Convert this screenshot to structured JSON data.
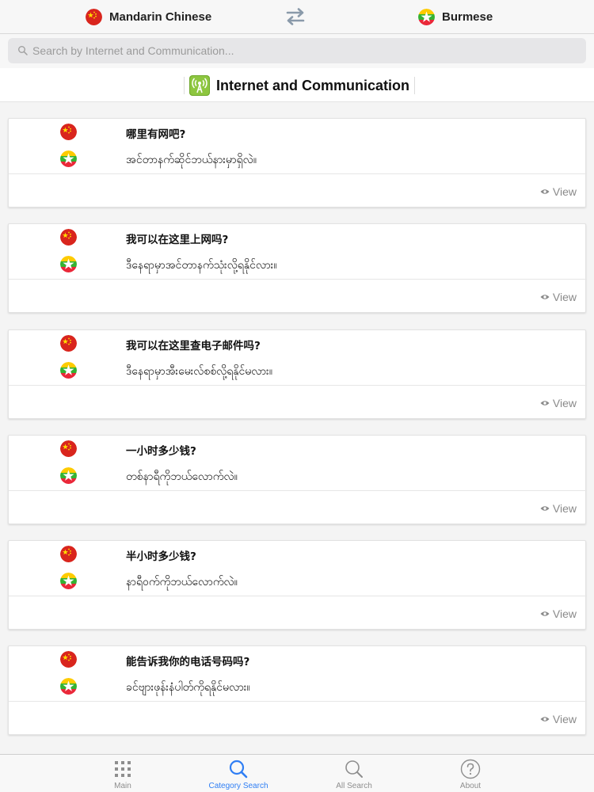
{
  "languages": {
    "source": {
      "name": "Mandarin Chinese",
      "flag_icon": "china-flag-icon"
    },
    "target": {
      "name": "Burmese",
      "flag_icon": "myanmar-flag-icon"
    },
    "swap_icon": "swap-arrows-icon"
  },
  "search": {
    "placeholder": "Search by Internet and Communication..."
  },
  "category": {
    "title": "Internet and Communication",
    "icon": "antenna-signal-icon",
    "icon_color": "#8dc63f"
  },
  "phrases": [
    {
      "zh": "哪里有网吧?",
      "my": "အင်တာနက်ဆိုင်ဘယ်နားမှာရှိလဲ။",
      "view_label": "View"
    },
    {
      "zh": "我可以在这里上网吗?",
      "my": "ဒီနေရာမှာအင်တာနက်သုံးလို့ရနိုင်လား။",
      "view_label": "View"
    },
    {
      "zh": "我可以在这里查电子邮件吗?",
      "my": "ဒီနေရာမှာအီးမေးလ်စစ်လို့ရနိုင်မလား။",
      "view_label": "View"
    },
    {
      "zh": "一小时多少钱?",
      "my": "တစ်နာရီကိုဘယ်လောက်လဲ။",
      "view_label": "View"
    },
    {
      "zh": "半小时多少钱?",
      "my": "နာရီဝက်ကိုဘယ်လောက်လဲ။",
      "view_label": "View"
    },
    {
      "zh": "能告诉我你的电话号码吗?",
      "my": "ခင်ဗျားဖုန်းနံပါတ်ကိုရနိုင်မလား။",
      "view_label": "View"
    }
  ],
  "tabs": [
    {
      "label": "Main",
      "icon": "grid-icon",
      "active": false
    },
    {
      "label": "Category Search",
      "icon": "search-icon",
      "active": true
    },
    {
      "label": "All Search",
      "icon": "search-icon",
      "active": false
    },
    {
      "label": "About",
      "icon": "question-circle-icon",
      "active": false
    }
  ],
  "colors": {
    "accent": "#2f7ef4",
    "muted": "#8e8e8e",
    "category_icon": "#8dc63f"
  }
}
